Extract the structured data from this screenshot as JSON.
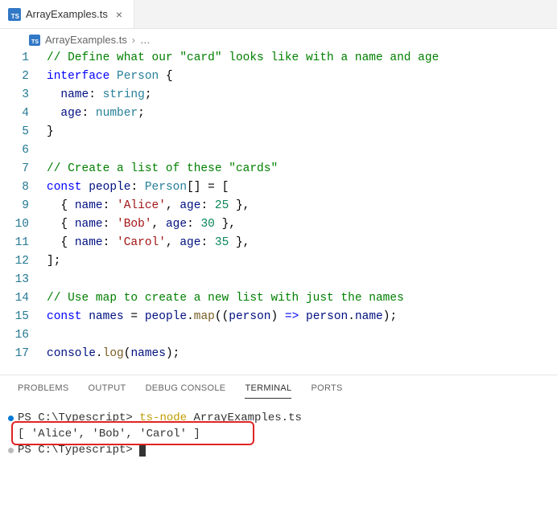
{
  "tab": {
    "filename": "ArrayExamples.ts"
  },
  "breadcrumb": {
    "filename": "ArrayExamples.ts",
    "more": "…"
  },
  "code": {
    "lines": [
      [
        {
          "c": "c-comment",
          "t": "// Define what our \"card\" looks like with a name and age"
        }
      ],
      [
        {
          "c": "c-keyword",
          "t": "interface"
        },
        {
          "c": "c-plain",
          "t": " "
        },
        {
          "c": "c-type",
          "t": "Person"
        },
        {
          "c": "c-plain",
          "t": " {"
        }
      ],
      [
        {
          "c": "c-plain",
          "t": "  "
        },
        {
          "c": "c-var",
          "t": "name"
        },
        {
          "c": "c-plain",
          "t": ": "
        },
        {
          "c": "c-type",
          "t": "string"
        },
        {
          "c": "c-plain",
          "t": ";"
        }
      ],
      [
        {
          "c": "c-plain",
          "t": "  "
        },
        {
          "c": "c-var",
          "t": "age"
        },
        {
          "c": "c-plain",
          "t": ": "
        },
        {
          "c": "c-type",
          "t": "number"
        },
        {
          "c": "c-plain",
          "t": ";"
        }
      ],
      [
        {
          "c": "c-plain",
          "t": "}"
        }
      ],
      [
        {
          "c": "c-plain",
          "t": ""
        }
      ],
      [
        {
          "c": "c-comment",
          "t": "// Create a list of these \"cards\""
        }
      ],
      [
        {
          "c": "c-keyword",
          "t": "const"
        },
        {
          "c": "c-plain",
          "t": " "
        },
        {
          "c": "c-var",
          "t": "people"
        },
        {
          "c": "c-plain",
          "t": ": "
        },
        {
          "c": "c-type",
          "t": "Person"
        },
        {
          "c": "c-plain",
          "t": "[] = ["
        }
      ],
      [
        {
          "c": "c-plain",
          "t": "  { "
        },
        {
          "c": "c-var",
          "t": "name"
        },
        {
          "c": "c-plain",
          "t": ": "
        },
        {
          "c": "c-string",
          "t": "'Alice'"
        },
        {
          "c": "c-plain",
          "t": ", "
        },
        {
          "c": "c-var",
          "t": "age"
        },
        {
          "c": "c-plain",
          "t": ": "
        },
        {
          "c": "c-number",
          "t": "25"
        },
        {
          "c": "c-plain",
          "t": " },"
        }
      ],
      [
        {
          "c": "c-plain",
          "t": "  { "
        },
        {
          "c": "c-var",
          "t": "name"
        },
        {
          "c": "c-plain",
          "t": ": "
        },
        {
          "c": "c-string",
          "t": "'Bob'"
        },
        {
          "c": "c-plain",
          "t": ", "
        },
        {
          "c": "c-var",
          "t": "age"
        },
        {
          "c": "c-plain",
          "t": ": "
        },
        {
          "c": "c-number",
          "t": "30"
        },
        {
          "c": "c-plain",
          "t": " },"
        }
      ],
      [
        {
          "c": "c-plain",
          "t": "  { "
        },
        {
          "c": "c-var",
          "t": "name"
        },
        {
          "c": "c-plain",
          "t": ": "
        },
        {
          "c": "c-string",
          "t": "'Carol'"
        },
        {
          "c": "c-plain",
          "t": ", "
        },
        {
          "c": "c-var",
          "t": "age"
        },
        {
          "c": "c-plain",
          "t": ": "
        },
        {
          "c": "c-number",
          "t": "35"
        },
        {
          "c": "c-plain",
          "t": " },"
        }
      ],
      [
        {
          "c": "c-plain",
          "t": "];"
        }
      ],
      [
        {
          "c": "c-plain",
          "t": ""
        }
      ],
      [
        {
          "c": "c-comment",
          "t": "// Use map to create a new list with just the names"
        }
      ],
      [
        {
          "c": "c-keyword",
          "t": "const"
        },
        {
          "c": "c-plain",
          "t": " "
        },
        {
          "c": "c-var",
          "t": "names"
        },
        {
          "c": "c-plain",
          "t": " = "
        },
        {
          "c": "c-var",
          "t": "people"
        },
        {
          "c": "c-plain",
          "t": "."
        },
        {
          "c": "c-func",
          "t": "map"
        },
        {
          "c": "c-plain",
          "t": "(("
        },
        {
          "c": "c-var",
          "t": "person"
        },
        {
          "c": "c-plain",
          "t": ") "
        },
        {
          "c": "c-keyword",
          "t": "=>"
        },
        {
          "c": "c-plain",
          "t": " "
        },
        {
          "c": "c-var",
          "t": "person"
        },
        {
          "c": "c-plain",
          "t": "."
        },
        {
          "c": "c-var",
          "t": "name"
        },
        {
          "c": "c-plain",
          "t": ");"
        }
      ],
      [
        {
          "c": "c-plain",
          "t": ""
        }
      ],
      [
        {
          "c": "c-var",
          "t": "console"
        },
        {
          "c": "c-plain",
          "t": "."
        },
        {
          "c": "c-func",
          "t": "log"
        },
        {
          "c": "c-plain",
          "t": "("
        },
        {
          "c": "c-var",
          "t": "names"
        },
        {
          "c": "c-plain",
          "t": ");"
        }
      ]
    ]
  },
  "panel": {
    "tabs": [
      "PROBLEMS",
      "OUTPUT",
      "DEBUG CONSOLE",
      "TERMINAL",
      "PORTS"
    ],
    "active": "TERMINAL"
  },
  "terminal": {
    "prompt1_prefix": "PS C:\\Typescript> ",
    "prompt1_cmd_tool": "ts-node",
    "prompt1_cmd_arg": " ArrayExamples.ts",
    "output_line": "[ 'Alice', 'Bob', 'Carol' ]",
    "prompt2": "PS C:\\Typescript> "
  }
}
